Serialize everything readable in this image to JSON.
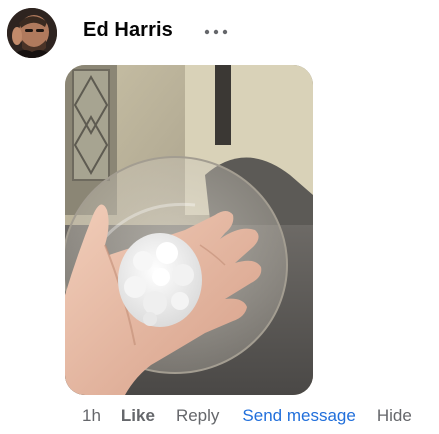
{
  "post": {
    "author_name": "Ed Harris",
    "more_options_icon": "more-horizontal-icon",
    "photo": {
      "subject": "hand holding a hailstone over a plastic container lid"
    }
  },
  "actions": {
    "timestamp": "1h",
    "like_label": "Like",
    "reply_label": "Reply",
    "send_message_label": "Send message",
    "hide_label": "Hide"
  },
  "colors": {
    "name_text": "#050505",
    "meta_text": "#65676b",
    "link_blue": "#216fdb"
  }
}
